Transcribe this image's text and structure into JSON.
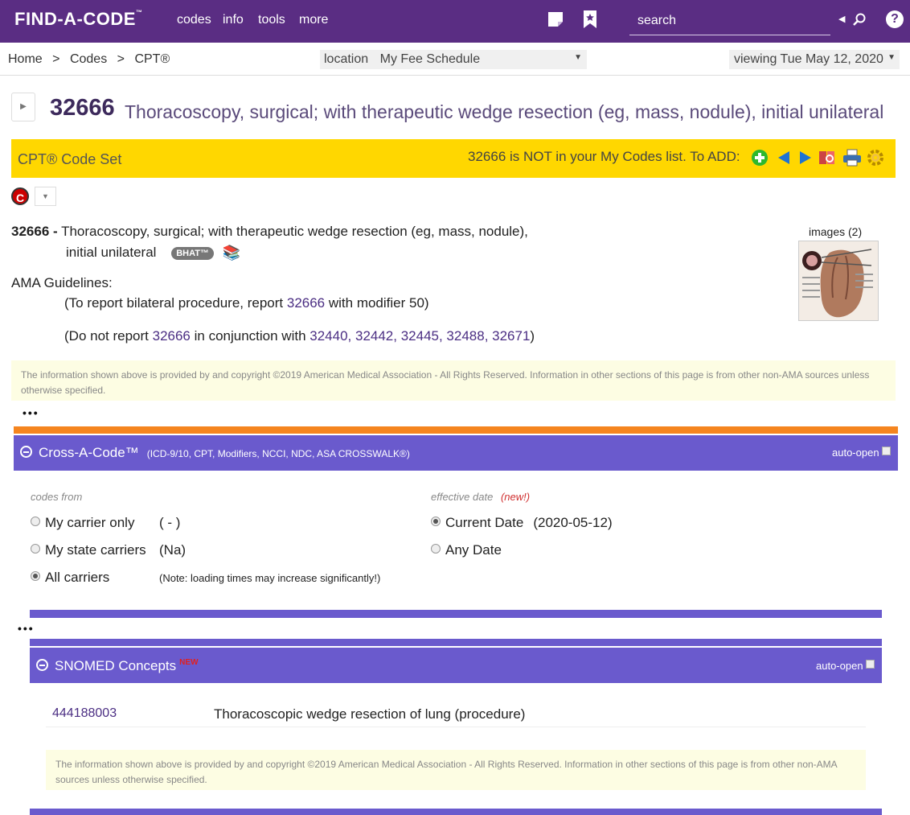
{
  "nav": {
    "logo": "FIND-A-CODE",
    "logo_tm": "™",
    "links": [
      "codes",
      "info",
      "tools",
      "more"
    ],
    "search_placeholder": "search"
  },
  "breadcrumb": {
    "home": "Home",
    "sep": ">",
    "codes": "Codes",
    "cpt": "CPT®"
  },
  "location": {
    "label": "location",
    "value": "My Fee Schedule"
  },
  "viewing": {
    "label": "viewing",
    "value": "Tue May 12, 2020"
  },
  "title": {
    "code": "32666",
    "desc": "Thoracoscopy, surgical; with therapeutic wedge resection (eg, mass, nodule), initial unilateral"
  },
  "toolbar": {
    "code_set": "CPT® Code Set",
    "message": "32666 is NOT in your My Codes list. To ADD:",
    "colors": {
      "bar": "#ffd700",
      "add": "#2eb82e",
      "arrow": "#1e73d2"
    }
  },
  "detail": {
    "code_prefix": "32666 -",
    "line1": "Thoracoscopy, surgical; with therapeutic wedge resection (eg, mass, nodule),",
    "line2": "initial unilateral",
    "badge": "BHAT™",
    "images_label": "images (2)",
    "ama_label": "AMA Guidelines:",
    "g1_pre": "(To report bilateral procedure, report ",
    "g1_code": "32666",
    "g1_post": " with modifier 50)",
    "g2_pre": "(Do not report ",
    "g2_code": "32666",
    "g2_mid": " in conjunction with ",
    "g2_codes": "32440, 32442, 32445, 32488, 32671",
    "g2_post": ")"
  },
  "copyright": "The information shown above is provided by and copyright ©2019 American Medical Association - All Rights Reserved.  Information in other sections of this page is from other non-AMA sources unless otherwise specified.",
  "ellipsis": "•••",
  "crosscode": {
    "title": "Cross-A-Code™",
    "subtitle": "(ICD-9/10, CPT, Modifiers, NCCI, NDC, ASA CROSSWALK®)",
    "auto_open": "auto-open",
    "codes_from_label": "codes from",
    "effective_label": "effective date",
    "new_label": "(new!)",
    "opt_carrier": "My carrier only",
    "opt_carrier_val": "( - )",
    "opt_state": "My state carriers",
    "opt_state_val": "(Na)",
    "opt_all": "All carriers",
    "opt_all_note": "(Note: loading times may increase significantly!)",
    "opt_current": "Current Date",
    "opt_current_val": "(2020-05-12)",
    "opt_any": "Any Date"
  },
  "snomed": {
    "title": "SNOMED Concepts",
    "new": "NEW",
    "auto_open": "auto-open",
    "code": "444188003",
    "desc": "Thoracoscopic wedge resection of lung (procedure)"
  }
}
